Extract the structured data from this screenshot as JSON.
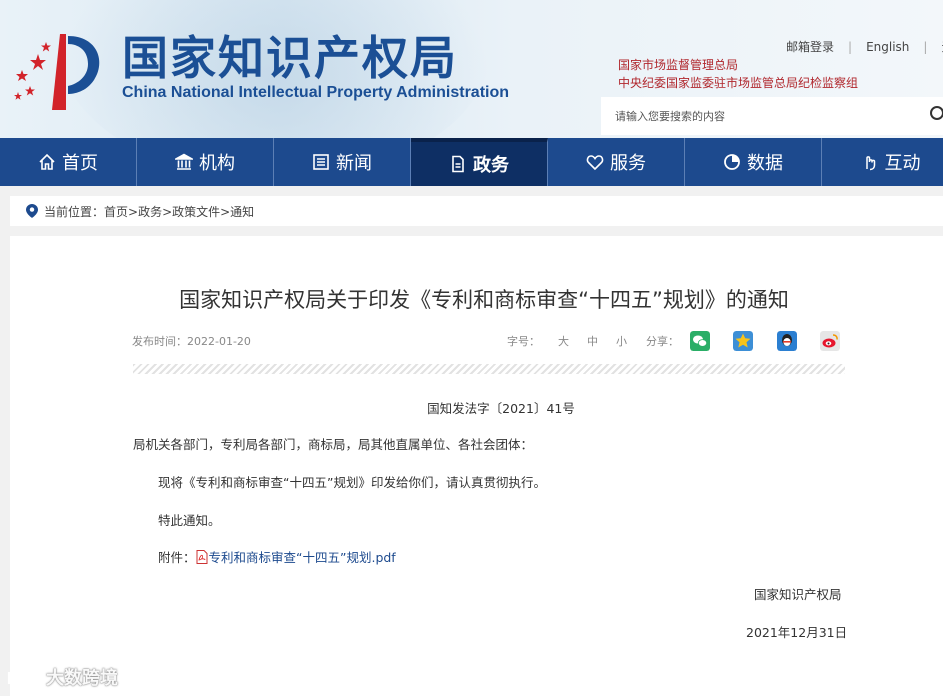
{
  "header": {
    "logo_cn": "国家知识产权局",
    "logo_en": "China National Intellectual Property Administration",
    "top_links": [
      "邮箱登录",
      "English",
      "无"
    ],
    "affiliations": [
      "国家市场监督管理总局",
      "中央纪委国家监委驻市场监管总局纪检监察组"
    ],
    "search_placeholder": "请输入您要搜索的内容"
  },
  "nav": {
    "items": [
      {
        "label": "首页",
        "icon": "home-icon"
      },
      {
        "label": "机构",
        "icon": "institution-icon"
      },
      {
        "label": "新闻",
        "icon": "news-icon"
      },
      {
        "label": "政务",
        "icon": "government-icon"
      },
      {
        "label": "服务",
        "icon": "service-icon"
      },
      {
        "label": "数据",
        "icon": "data-icon"
      },
      {
        "label": "互动",
        "icon": "interaction-icon"
      }
    ],
    "active": "政务",
    "color": "#1d4a8e",
    "active_color": "#0e2f64"
  },
  "breadcrumb": {
    "label": "当前位置：",
    "path": "首页>政务>政策文件>通知"
  },
  "article": {
    "title": "国家知识产权局关于印发《专利和商标审查“十四五”规划》的通知",
    "publish_time": "发布时间：2022-01-20",
    "font_size_label": "字号：",
    "font_sizes": [
      "大",
      "中",
      "小"
    ],
    "share_label": "分享：",
    "share_icons": [
      "wechat-icon",
      "qzone-icon",
      "qq-icon",
      "weibo-icon"
    ],
    "doc_number": "国知发法字〔2021〕41号",
    "addressee": "局机关各部门，专利局各部门，商标局，局其他直属单位、各社会团体：",
    "body1": "现将《专利和商标审查“十四五”规划》印发给你们，请认真贯彻执行。",
    "body2": "特此通知。",
    "attachment_label": "附件：",
    "attachment_name": "专利和商标审查“十四五”规划.pdf",
    "signature": "国家知识产权局",
    "date": "2021年12月31日"
  },
  "watermark": "大数跨境"
}
